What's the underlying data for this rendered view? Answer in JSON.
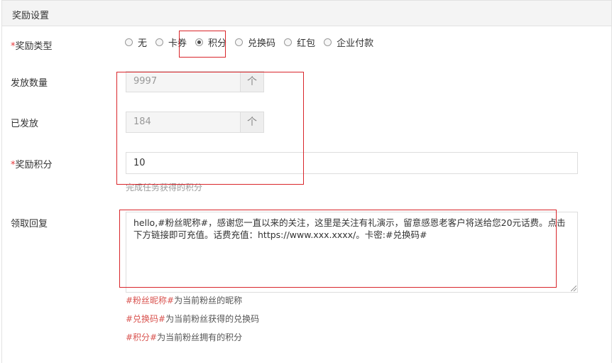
{
  "panel": {
    "title": "奖励设置"
  },
  "reward_type": {
    "required_mark": "*",
    "label": "奖励类型",
    "options": [
      {
        "label": "无",
        "selected": false
      },
      {
        "label": "卡券",
        "selected": false
      },
      {
        "label": "积分",
        "selected": true
      },
      {
        "label": "兑换码",
        "selected": false
      },
      {
        "label": "红包",
        "selected": false
      },
      {
        "label": "企业付款",
        "selected": false
      }
    ]
  },
  "issue_count": {
    "label": "发放数量",
    "value": "9997",
    "addon": "个"
  },
  "issued": {
    "label": "已发放",
    "value": "184",
    "addon": "个"
  },
  "reward_points": {
    "required_mark": "*",
    "label": "奖励积分",
    "value": "10",
    "help": "完成任务获得的积分"
  },
  "reply": {
    "label": "领取回复",
    "value": "hello,#粉丝昵称#，感谢您一直以来的关注，这里是关注有礼演示，留意感恩老客户将送给您20元话费。点击下方链接即可充值。话费充值：https://www.xxx.xxxx/。卡密:#兑换码#"
  },
  "hints": [
    {
      "tag": "#粉丝昵称#",
      "text": "为当前粉丝的昵称"
    },
    {
      "tag": "#兑换码#",
      "text": "为当前粉丝获得的兑换码"
    },
    {
      "tag": "#积分#",
      "text": "为当前粉丝拥有的积分"
    }
  ],
  "colors": {
    "highlight_box": "#d9262b",
    "required": "#e4393c",
    "hint_tag": "#d9534f"
  }
}
